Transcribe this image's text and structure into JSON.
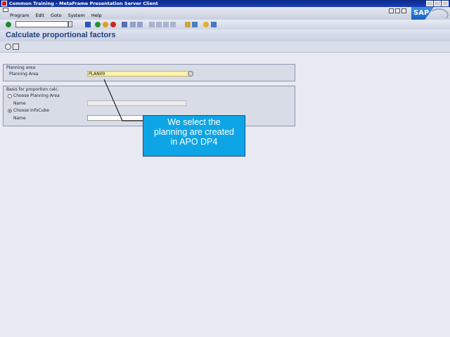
{
  "window": {
    "title": "Common Training - MetaFrame Presentation Server Client"
  },
  "menu": {
    "items": [
      "Program",
      "Edit",
      "Goto",
      "System",
      "Help"
    ]
  },
  "logo": "SAP",
  "icons": {
    "ok": "checkmark-icon",
    "save": "save-icon",
    "back": "back-icon",
    "exit": "exit-icon",
    "cancel": "cancel-icon",
    "print": "print-icon",
    "find": "find-icon",
    "help": "help-icon"
  },
  "screen": {
    "title": "Calculate proportional factors"
  },
  "planning_area_group": {
    "title": "Planning area",
    "field_label": "Planning Area",
    "field_value": "PLAN00"
  },
  "basis_group": {
    "title": "Basis for proportion calc.",
    "option1_label": "Choose Planning Area",
    "name1_label": "Name",
    "option2_label": "Choose InfoCube",
    "name2_label": "Name",
    "selected": "Choose InfoCube"
  },
  "annotation": {
    "lines": [
      "We select the",
      "planning are created",
      "in APO DP4"
    ]
  },
  "colors": {
    "callout": "#0ea5e6",
    "required_field": "#fdf2a6",
    "title_blue": "#1f3f7e"
  }
}
